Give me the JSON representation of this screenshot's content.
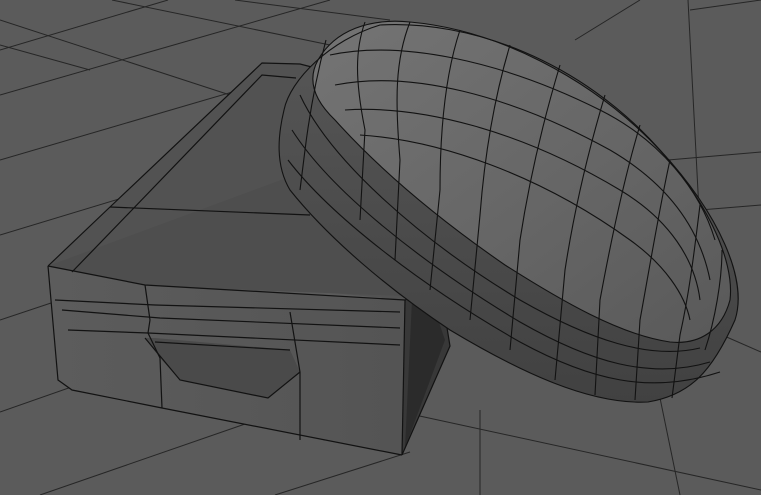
{
  "viewport": {
    "background": "#5b5b5b",
    "grid_color": "#262626",
    "wire_color": "#121212",
    "box_top_color": "#555555",
    "box_front_color": "#5a5a5a",
    "box_side_color": "#3a3a3a",
    "box_inner_dark": "#2c2c2c",
    "lid_top_color": "#6a6a6a",
    "lid_rim_color": "#505050",
    "lid_band_color": "#4a4a4a"
  }
}
